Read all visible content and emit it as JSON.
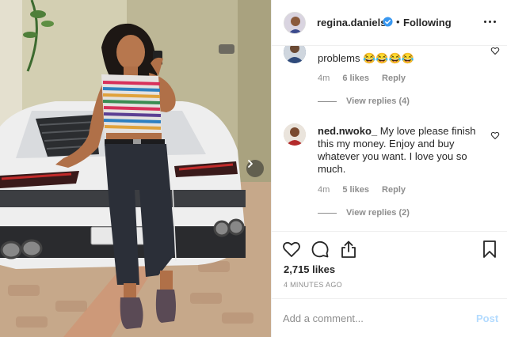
{
  "header": {
    "username": "regina.daniels",
    "verified": true,
    "separator": "•",
    "follow_status": "Following",
    "more_icon": "more-horizontal-icon"
  },
  "comments": [
    {
      "username": "",
      "text": "problems 😂😂😂😂",
      "age": "4m",
      "likes": "6 likes",
      "reply_label": "Reply",
      "view_replies": "View replies (4)"
    },
    {
      "username": "ned.nwoko_",
      "text": "My love please finish this my money. Enjoy and buy whatever you want. I love you so much.",
      "age": "4m",
      "likes": "5 likes",
      "reply_label": "Reply",
      "view_replies": "View replies (2)"
    }
  ],
  "actions": {
    "icons": [
      "heart-icon",
      "comment-icon",
      "share-icon",
      "bookmark-icon"
    ],
    "likes": "2,715 likes",
    "time": "4 MINUTES AGO"
  },
  "add_comment": {
    "placeholder": "Add a comment...",
    "post_label": "Post"
  },
  "colors": {
    "text": "#262626",
    "muted": "#8e8e8e",
    "border": "#efefef",
    "post_disabled": "#b3dbff",
    "verified_blue": "#3897f0"
  }
}
